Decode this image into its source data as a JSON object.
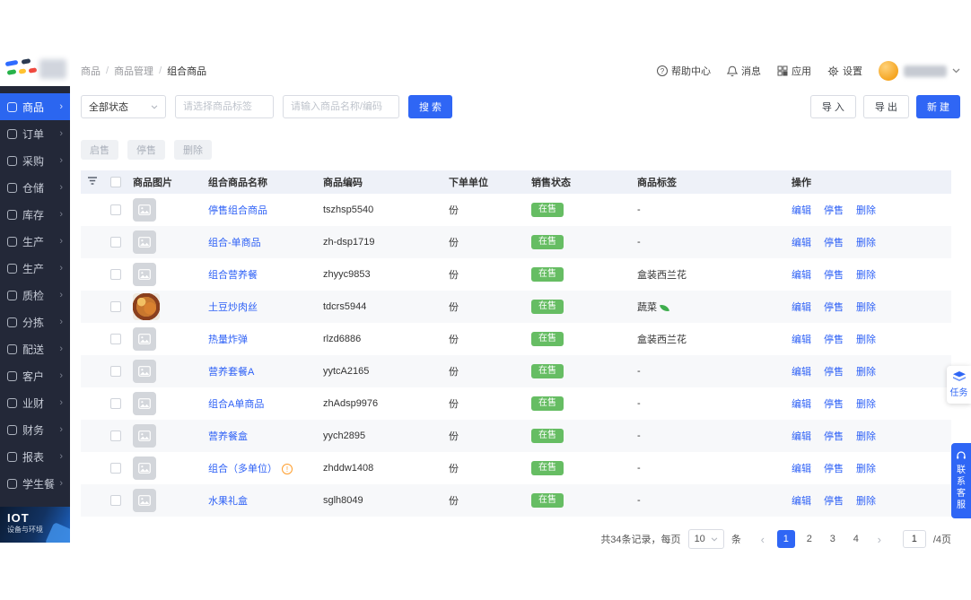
{
  "app": {
    "primary_color": "#2f66f5",
    "success_color": "#66bd63",
    "sidebar_color": "#232838"
  },
  "sidebar": {
    "app_name": "IOT",
    "app_sub": "设备与环境",
    "items": [
      {
        "key": "shangpin",
        "label": "商品",
        "active": true
      },
      {
        "key": "dingdan",
        "label": "订单",
        "active": false
      },
      {
        "key": "caigou",
        "label": "采购",
        "active": false
      },
      {
        "key": "cangchu",
        "label": "仓储",
        "active": false
      },
      {
        "key": "kucun",
        "label": "库存",
        "active": false
      },
      {
        "key": "shengchan",
        "label": "生产",
        "active": false
      },
      {
        "key": "shengchan-2",
        "label": "生产",
        "active": false
      },
      {
        "key": "zhijian",
        "label": "质检",
        "active": false
      },
      {
        "key": "fenjian",
        "label": "分拣",
        "active": false
      },
      {
        "key": "peisong",
        "label": "配送",
        "active": false
      },
      {
        "key": "kehu",
        "label": "客户",
        "active": false
      },
      {
        "key": "yecai",
        "label": "业财",
        "active": false
      },
      {
        "key": "caiwu",
        "label": "财务",
        "active": false
      },
      {
        "key": "baobiao",
        "label": "报表",
        "active": false
      },
      {
        "key": "xueshengcan",
        "label": "学生餐",
        "active": false
      }
    ]
  },
  "breadcrumb": [
    "商品",
    "商品管理",
    "组合商品"
  ],
  "topbar": {
    "help": "帮助中心",
    "messages": "消息",
    "apps": "应用",
    "settings": "设置"
  },
  "filters": {
    "status_value": "全部状态",
    "tag_placeholder": "请选择商品标签",
    "search_placeholder": "请输入商品名称/编码",
    "search_label": "搜 索",
    "import_label": "导 入",
    "export_label": "导 出",
    "create_label": "新 建"
  },
  "bulk": {
    "enable_label": "启售",
    "stop_label": "停售",
    "delete_label": "删除"
  },
  "table": {
    "columns": [
      "商品图片",
      "组合商品名称",
      "商品编码",
      "下单单位",
      "销售状态",
      "商品标签",
      "操作"
    ],
    "actions": [
      {
        "key": "edit",
        "label": "编辑"
      },
      {
        "key": "stop",
        "label": "停售"
      },
      {
        "key": "delete",
        "label": "删除"
      }
    ],
    "rows": [
      {
        "name": "停售组合商品",
        "code": "tszhsp5540",
        "unit": "份",
        "status": "在售",
        "tag": "-",
        "has_image": false,
        "has_info": false,
        "has_leaf": false
      },
      {
        "name": "组合-单商品",
        "code": "zh-dsp1719",
        "unit": "份",
        "status": "在售",
        "tag": "-",
        "has_image": false,
        "has_info": false,
        "has_leaf": false
      },
      {
        "name": "组合营养餐",
        "code": "zhyyc9853",
        "unit": "份",
        "status": "在售",
        "tag": "盒装西兰花",
        "has_image": false,
        "has_info": false,
        "has_leaf": false
      },
      {
        "name": "土豆炒肉丝",
        "code": "tdcrs5944",
        "unit": "份",
        "status": "在售",
        "tag": "蔬菜",
        "has_image": true,
        "has_info": false,
        "has_leaf": true
      },
      {
        "name": "热量炸弹",
        "code": "rlzd6886",
        "unit": "份",
        "status": "在售",
        "tag": "盒装西兰花",
        "has_image": false,
        "has_info": false,
        "has_leaf": false
      },
      {
        "name": "营养套餐A",
        "code": "yytcA2165",
        "unit": "份",
        "status": "在售",
        "tag": "-",
        "has_image": false,
        "has_info": false,
        "has_leaf": false
      },
      {
        "name": "组合A单商品",
        "code": "zhAdsp9976",
        "unit": "份",
        "status": "在售",
        "tag": "-",
        "has_image": false,
        "has_info": false,
        "has_leaf": false
      },
      {
        "name": "营养餐盒",
        "code": "yych2895",
        "unit": "份",
        "status": "在售",
        "tag": "-",
        "has_image": false,
        "has_info": false,
        "has_leaf": false
      },
      {
        "name": "组合（多单位）",
        "code": "zhddw1408",
        "unit": "份",
        "status": "在售",
        "tag": "-",
        "has_image": false,
        "has_info": true,
        "has_leaf": false
      },
      {
        "name": "水果礼盒",
        "code": "sglh8049",
        "unit": "份",
        "status": "在售",
        "tag": "-",
        "has_image": false,
        "has_info": false,
        "has_leaf": false
      }
    ]
  },
  "pagination": {
    "total_text": "共34条记录，每页",
    "page_size": "10",
    "unit_label": "条",
    "prev_icon": "‹",
    "next_icon": "›",
    "pages": [
      "1",
      "2",
      "3",
      "4"
    ],
    "active_page": "1",
    "jump_value": "1",
    "total_pages_label": "/4页"
  },
  "floating": {
    "task_label": "任务",
    "service_label": "联系客服"
  }
}
